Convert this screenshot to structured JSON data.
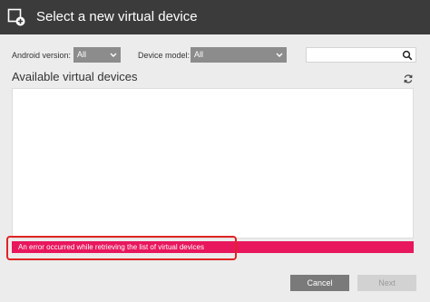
{
  "dialog": {
    "title": "Select a new virtual device",
    "title_icon": "add-device-icon"
  },
  "filters": {
    "android_version_label": "Android version:",
    "android_version_value": "All",
    "device_model_label": "Device model:",
    "device_model_value": "All",
    "search_placeholder": "",
    "search_icon": "search-icon"
  },
  "list": {
    "heading": "Available virtual devices",
    "refresh_icon": "refresh-icon",
    "items": []
  },
  "error": {
    "message": "An error occurred while retrieving the list of virtual devices",
    "color": "#e8175d",
    "highlight_color": "#e02424"
  },
  "footer": {
    "cancel_label": "Cancel",
    "next_label": "Next"
  },
  "colors": {
    "titlebar": "#3b3b3b",
    "select": "#8c8c8c",
    "cancel_button": "#7a7a7a",
    "next_button_disabled": "#d2d2d2"
  }
}
